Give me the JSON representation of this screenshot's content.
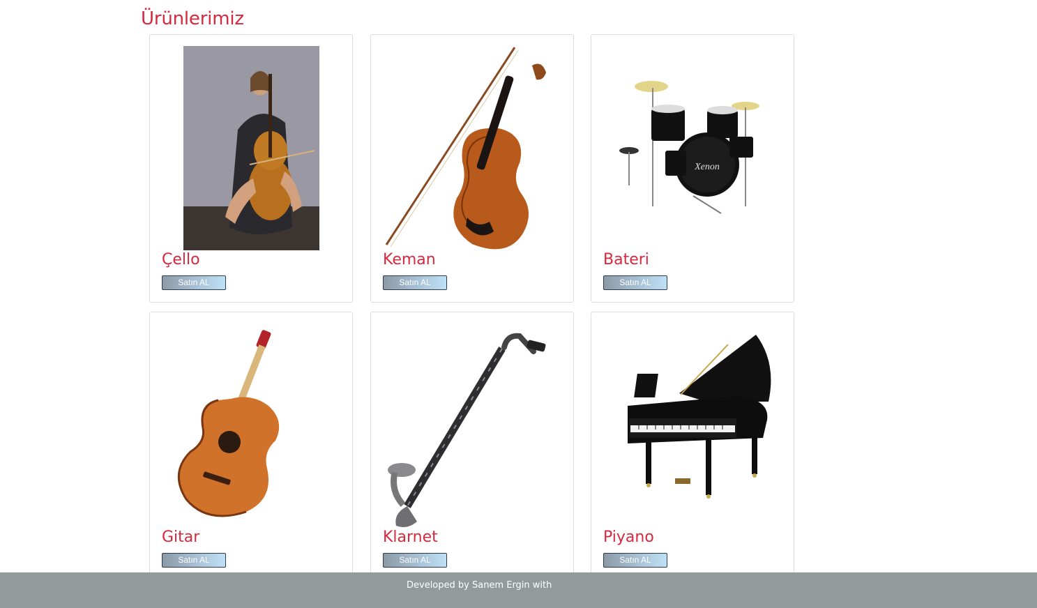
{
  "page": {
    "title": "Ürünlerimiz"
  },
  "products": [
    {
      "name": "Çello",
      "button": "Satın AL",
      "image": "cello-player-photo"
    },
    {
      "name": "Keman",
      "button": "Satın AL",
      "image": "violin-with-bow"
    },
    {
      "name": "Bateri",
      "button": "Satın AL",
      "image": "drum-kit"
    },
    {
      "name": "Gitar",
      "button": "Satın AL",
      "image": "acoustic-guitar"
    },
    {
      "name": "Klarnet",
      "button": "Satın AL",
      "image": "bass-clarinet"
    },
    {
      "name": "Piyano",
      "button": "Satın AL",
      "image": "grand-piano"
    }
  ],
  "footer": {
    "text": "Developed by Sanem Ergin with"
  },
  "colors": {
    "accent": "#d9283e",
    "footer_bg": "#939a9c",
    "card_border": "#dcdcdc"
  }
}
